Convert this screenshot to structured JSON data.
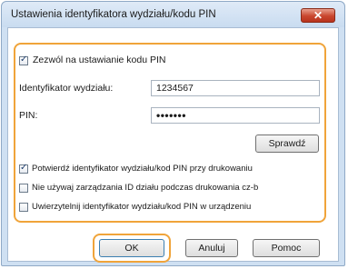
{
  "dialog": {
    "title": "Ustawienia identyfikatora wydziału/kodu PIN",
    "close_label": "✕"
  },
  "settings": {
    "allow_pin_label": "Zezwól na ustawianie kodu PIN",
    "allow_pin_checked": true,
    "department_id_label": "Identyfikator wydziału:",
    "department_id_value": "1234567",
    "pin_label": "PIN:",
    "pin_value": "•••••••",
    "verify_button": "Sprawdź",
    "confirm_on_print_label": "Potwierdź identyfikator wydziału/kod PIN przy drukowaniu",
    "confirm_on_print_checked": true,
    "no_id_management_label": "Nie używaj zarządzania ID działu podczas drukowania cz-b",
    "no_id_management_checked": false,
    "authenticate_on_device_label": "Uwierzytelnij identyfikator wydziału/kod PIN w urządzeniu",
    "authenticate_on_device_checked": false
  },
  "footer": {
    "ok_label": "OK",
    "cancel_label": "Anuluj",
    "help_label": "Pomoc"
  }
}
